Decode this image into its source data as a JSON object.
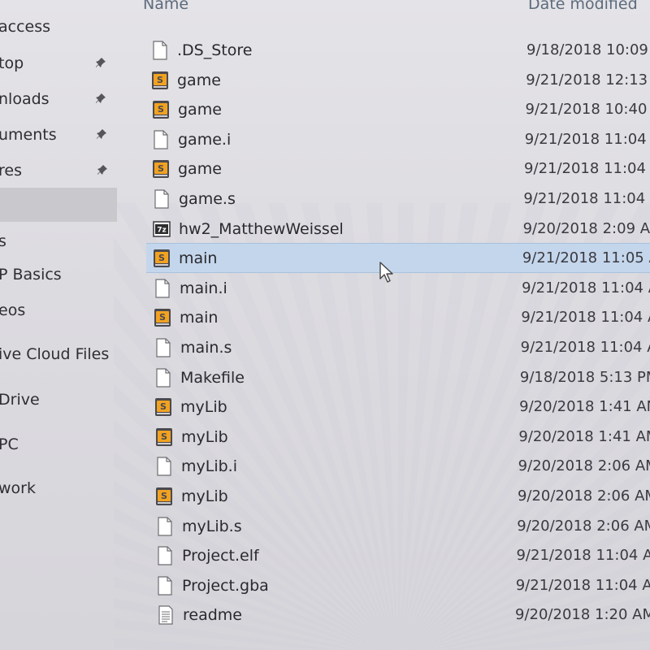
{
  "header": {
    "name_label": "Name",
    "date_label": "Date modified"
  },
  "sidebar": {
    "items": [
      {
        "label": "access",
        "pinned": false
      },
      {
        "label": "top",
        "pinned": true
      },
      {
        "label": "nloads",
        "pinned": true
      },
      {
        "label": "uments",
        "pinned": true
      },
      {
        "label": "res",
        "pinned": true
      },
      {
        "label": "",
        "pinned": false,
        "selected": true
      },
      {
        "label": "s",
        "pinned": false
      },
      {
        "label": "P Basics",
        "pinned": false
      },
      {
        "label": "eos",
        "pinned": false
      },
      {
        "label": "ive Cloud Files",
        "pinned": false
      },
      {
        "label": "Drive",
        "pinned": false
      },
      {
        "label": "PC",
        "pinned": false
      },
      {
        "label": "work",
        "pinned": false
      }
    ]
  },
  "files": [
    {
      "name": ".DS_Store",
      "date": "9/18/2018 10:09",
      "icon": "blank-file-icon"
    },
    {
      "name": "game",
      "date": "9/21/2018 12:13",
      "icon": "sublime-file-icon"
    },
    {
      "name": "game",
      "date": "9/21/2018 10:40",
      "icon": "sublime-file-icon"
    },
    {
      "name": "game.i",
      "date": "9/21/2018 11:04",
      "icon": "blank-file-icon"
    },
    {
      "name": "game",
      "date": "9/21/2018 11:04",
      "icon": "sublime-file-icon"
    },
    {
      "name": "game.s",
      "date": "9/21/2018 11:04",
      "icon": "blank-file-icon"
    },
    {
      "name": "hw2_MatthewWeissel",
      "date": "9/20/2018 2:09 A",
      "icon": "7z-archive-icon"
    },
    {
      "name": "main",
      "date": "9/21/2018 11:05 A",
      "icon": "sublime-file-icon",
      "selected": true
    },
    {
      "name": "main.i",
      "date": "9/21/2018 11:04 A",
      "icon": "blank-file-icon"
    },
    {
      "name": "main",
      "date": "9/21/2018 11:04 A",
      "icon": "sublime-file-icon"
    },
    {
      "name": "main.s",
      "date": "9/21/2018 11:04 A",
      "icon": "blank-file-icon"
    },
    {
      "name": "Makefile",
      "date": "9/18/2018 5:13 PM",
      "icon": "blank-file-icon"
    },
    {
      "name": "myLib",
      "date": "9/20/2018 1:41 AM",
      "icon": "sublime-file-icon"
    },
    {
      "name": "myLib",
      "date": "9/20/2018 1:41 AM",
      "icon": "sublime-file-icon"
    },
    {
      "name": "myLib.i",
      "date": "9/20/2018 2:06 AM",
      "icon": "blank-file-icon"
    },
    {
      "name": "myLib",
      "date": "9/20/2018 2:06 AM",
      "icon": "sublime-file-icon"
    },
    {
      "name": "myLib.s",
      "date": "9/20/2018 2:06 AM",
      "icon": "blank-file-icon"
    },
    {
      "name": "Project.elf",
      "date": "9/21/2018 11:04 A",
      "icon": "blank-file-icon"
    },
    {
      "name": "Project.gba",
      "date": "9/21/2018 11:04 A",
      "icon": "blank-file-icon"
    },
    {
      "name": "readme",
      "date": "9/20/2018 1:20 AM",
      "icon": "text-file-icon"
    }
  ],
  "colors": {
    "selection": "#c4d6ec",
    "nav_selected": "#c9c8cc",
    "header_text": "#5d6b7c",
    "sublime_orange": "#f29a1f"
  }
}
